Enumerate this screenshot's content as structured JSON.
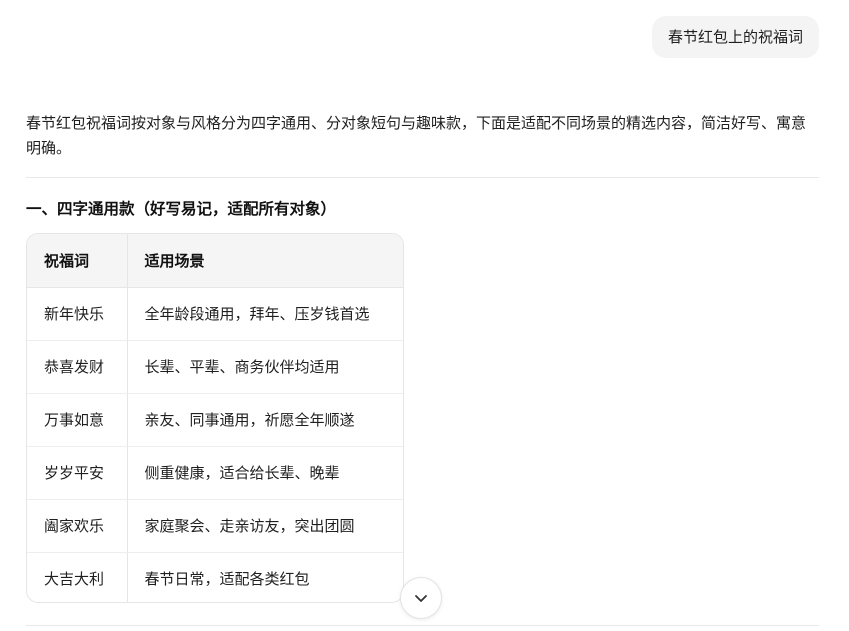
{
  "user_message": "春节红包上的祝福词",
  "response": {
    "intro": "春节红包祝福词按对象与风格分为四字通用、分对象短句与趣味款，下面是适配不同场景的精选内容，简洁好写、寓意明确。",
    "section_1": {
      "heading": "一、四字通用款（好写易记，适配所有对象）",
      "table": {
        "headers": [
          "祝福词",
          "适用场景"
        ],
        "rows": [
          [
            "新年快乐",
            "全年龄段通用，拜年、压岁钱首选"
          ],
          [
            "恭喜发财",
            "长辈、平辈、商务伙伴均适用"
          ],
          [
            "万事如意",
            "亲友、同事通用，祈愿全年顺遂"
          ],
          [
            "岁岁平安",
            "侧重健康，适合给长辈、晚辈"
          ],
          [
            "阖家欢乐",
            "家庭聚会、走亲访友，突出团圆"
          ],
          [
            "大吉大利",
            "春节日常，适配各类红包"
          ]
        ]
      }
    }
  },
  "icons": {
    "scroll_down": "chevron-down-icon"
  }
}
